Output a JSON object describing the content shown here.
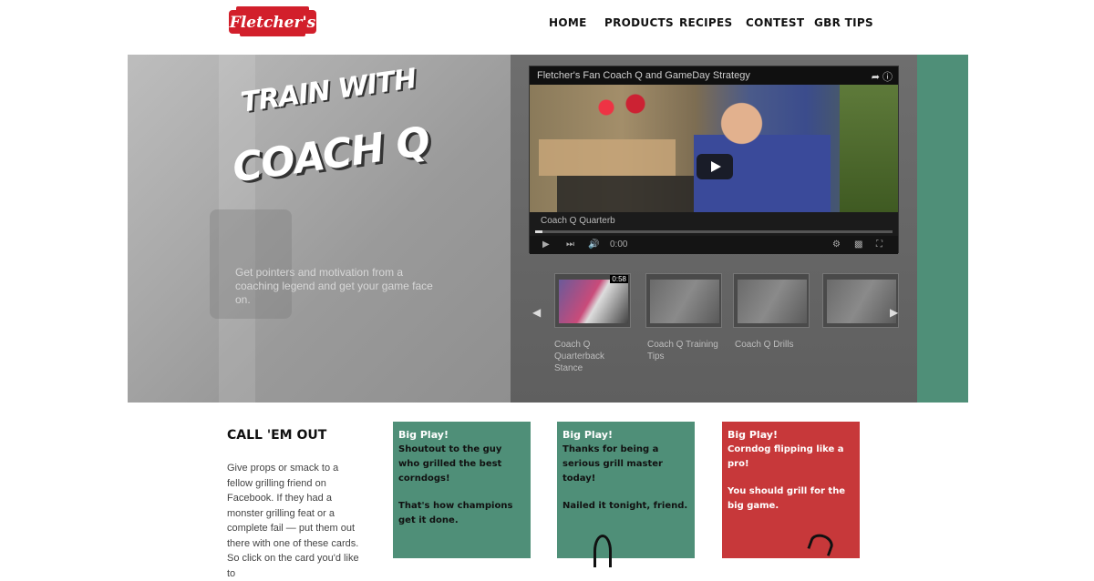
{
  "brand": {
    "logo_text": "Fletcher's",
    "colors": {
      "green": "#4f8f78",
      "red": "#c7383a",
      "logo_red": "#d21f2b"
    }
  },
  "nav": {
    "items": [
      "HOME",
      "PRODUCTS",
      "RECIPES",
      "CONTEST",
      "GBR TIPS"
    ]
  },
  "hero": {
    "title_line1": "TRAIN WITH",
    "title_line2": "COACH Q",
    "description": "Get pointers and motivation from a coaching legend and get your game face on."
  },
  "player": {
    "title": "Fletcher's Fan Coach Q and GameDay Strategy",
    "share_icon": "share-icon",
    "info_icon": "info-icon",
    "caption": "Coach Q Quarterb",
    "progress": 0.02,
    "time": "0:00",
    "controls": [
      "play-icon",
      "next-icon",
      "volume-icon",
      "settings-icon",
      "fullscreen-icon"
    ]
  },
  "thumbnails": {
    "items": [
      {
        "label": "Coach Q Quarterback Stance",
        "duration": "0:58",
        "active": true
      },
      {
        "label": "Coach Q Training Tips",
        "duration": "",
        "active": false
      },
      {
        "label": "Coach Q Drills",
        "duration": "",
        "active": false
      },
      {
        "label": "",
        "duration": "",
        "active": false
      }
    ],
    "prev_icon": "chevron-left-icon",
    "next_icon": "chevron-right-icon"
  },
  "call_em_out": {
    "heading": "CALL 'EM OUT",
    "text": "Give props or smack to a fellow grilling friend on Facebook. If they had a monster grilling feat or a complete fail — put them out there with one of these cards. So click on the card you'd like to"
  },
  "cards": [
    {
      "tag": "Big Play!",
      "head": "Shoutout to the guy who grilled the best corndogs!",
      "sub": "That's how champions get it done.",
      "color": "#4f8f78"
    },
    {
      "tag": "Big Play!",
      "head": "Thanks for being a serious grill master today!",
      "sub": "Nailed it tonight, friend.",
      "color": "#4f8f78"
    },
    {
      "tag": "Big Play!",
      "head": "Corndog flipping like a pro!",
      "sub": "You should grill for the big game.",
      "color": "#c7383a"
    }
  ]
}
